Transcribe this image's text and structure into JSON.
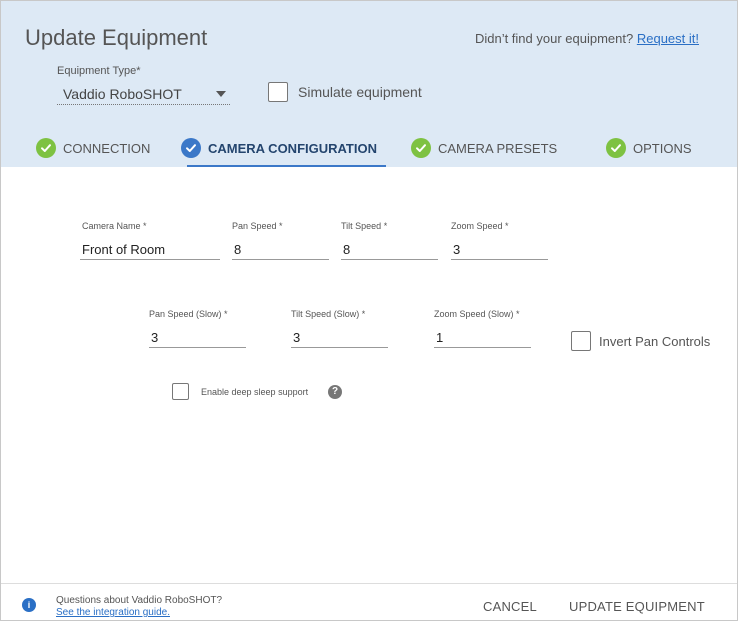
{
  "dialog": {
    "title": "Update Equipment",
    "request_prompt": "Didn’t find your equipment?",
    "request_link": "Request it!"
  },
  "equipment": {
    "type_label": "Equipment Type*",
    "type_value": "Vaddio RoboSHOT",
    "simulate_label": "Simulate equipment",
    "simulate_checked": false
  },
  "tabs": [
    {
      "label": "CONNECTION",
      "state": "complete"
    },
    {
      "label": "CAMERA CONFIGURATION",
      "state": "active"
    },
    {
      "label": "CAMERA PRESETS",
      "state": "complete"
    },
    {
      "label": "OPTIONS",
      "state": "complete"
    }
  ],
  "form": {
    "row1": [
      {
        "label": "Camera Name *",
        "value": "Front of Room"
      },
      {
        "label": "Pan Speed *",
        "value": "8"
      },
      {
        "label": "Tilt Speed *",
        "value": "8"
      },
      {
        "label": "Zoom Speed *",
        "value": "3"
      }
    ],
    "row2": [
      {
        "label": "Pan Speed  (Slow) *",
        "value": "3"
      },
      {
        "label": "Tilt Speed  (Slow) *",
        "value": "3"
      },
      {
        "label": "Zoom Speed  (Slow) *",
        "value": "1"
      }
    ],
    "invert_pan_label": "Invert Pan Controls",
    "deep_sleep_label": "Enable deep sleep support",
    "help_glyph": "?"
  },
  "footer": {
    "info_glyph": "i",
    "question": "Questions about Vaddio RoboSHOT?",
    "guide_link": "See the integration guide.",
    "cancel": "CANCEL",
    "update": "UPDATE EQUIPMENT"
  },
  "colors": {
    "header_bg": "#dde9f5",
    "accent_blue": "#3b78c8",
    "complete_green": "#7ec242",
    "link_blue": "#2a6fc5"
  }
}
